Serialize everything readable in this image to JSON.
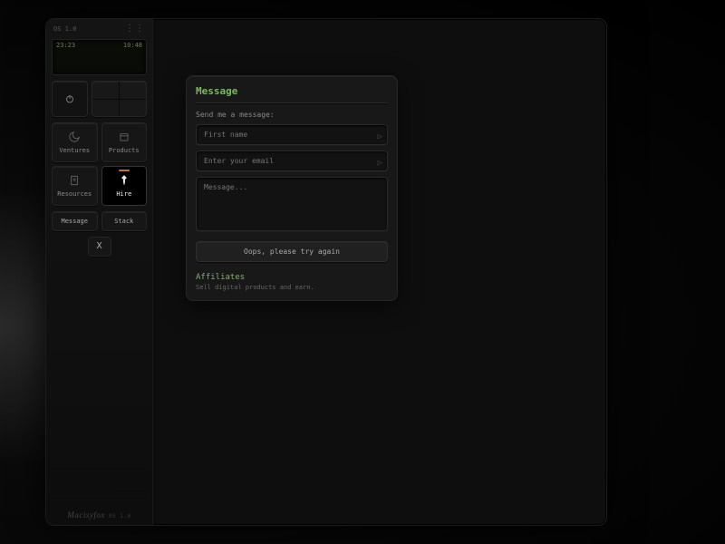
{
  "sidebar": {
    "version_label": "OS 1.0",
    "lcd": {
      "left": "23:23",
      "right": "10:48"
    },
    "grid": [
      {
        "name": "ventures",
        "label": "Ventures",
        "icon": "moon",
        "active": false,
        "badge": false
      },
      {
        "name": "products",
        "label": "Products",
        "icon": "package",
        "active": false,
        "badge": false
      },
      {
        "name": "resources",
        "label": "Resources",
        "icon": "doc",
        "active": false,
        "badge": false
      },
      {
        "name": "hire",
        "label": "Hire",
        "icon": "pin",
        "active": true,
        "badge": true
      }
    ],
    "pills": {
      "message": "Message",
      "stack": "Stack"
    },
    "close_label": "X",
    "brand": "Macisyfox",
    "brand_version": "OS 1.0"
  },
  "panel": {
    "title": "Message",
    "subtitle": "Send me a message:",
    "first_name_placeholder": "First name",
    "email_placeholder": "Enter your email",
    "message_placeholder": "Message...",
    "submit_label": "Oops, please try again",
    "affiliates_title": "Affiliates",
    "affiliates_sub": "Sell digital products and earn."
  }
}
